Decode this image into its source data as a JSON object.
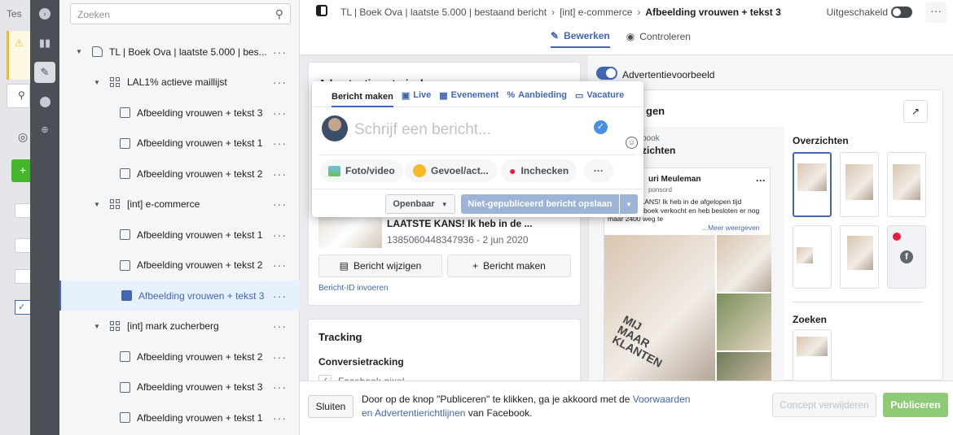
{
  "left": {
    "truncated_label": "Tes"
  },
  "rail": {
    "items": [
      "expand-icon",
      "chart-icon",
      "pencil-icon",
      "clock-icon",
      "search-chart-icon"
    ]
  },
  "search": {
    "placeholder": "Zoeken"
  },
  "tree": [
    {
      "label": "TL | Boek Ova | laatste 5.000 | bes...",
      "type": "campaign",
      "level": 0,
      "selected": false
    },
    {
      "label": "LAL1% actieve maillijst",
      "type": "adset",
      "level": 1,
      "selected": false
    },
    {
      "label": "Afbeelding vrouwen + tekst 3",
      "type": "ad",
      "level": 2,
      "selected": false
    },
    {
      "label": "Afbeelding vrouwen + tekst 1",
      "type": "ad",
      "level": 2,
      "selected": false
    },
    {
      "label": "Afbeelding vrouwen + tekst 2",
      "type": "ad",
      "level": 2,
      "selected": false
    },
    {
      "label": "[int] e-commerce",
      "type": "adset",
      "level": 1,
      "selected": false
    },
    {
      "label": "Afbeelding vrouwen + tekst 1",
      "type": "ad",
      "level": 2,
      "selected": false
    },
    {
      "label": "Afbeelding vrouwen + tekst 2",
      "type": "ad",
      "level": 2,
      "selected": false
    },
    {
      "label": "Afbeelding vrouwen + tekst 3",
      "type": "ad",
      "level": 2,
      "selected": true
    },
    {
      "label": "[int] mark zucherberg",
      "type": "adset",
      "level": 1,
      "selected": false
    },
    {
      "label": "Afbeelding vrouwen + tekst 2",
      "type": "ad",
      "level": 2,
      "selected": false
    },
    {
      "label": "Afbeelding vrouwen + tekst 3",
      "type": "ad",
      "level": 2,
      "selected": false
    },
    {
      "label": "Afbeelding vrouwen + tekst 1",
      "type": "ad",
      "level": 2,
      "selected": false
    }
  ],
  "breadcrumb": {
    "part1": "TL | Boek Ova | laatste 5.000 | bestaand bericht",
    "part2": "[int] e-commerce",
    "part3": "Afbeelding vrouwen + tekst 3"
  },
  "status": {
    "label": "Uitgeschakeld"
  },
  "tabs": {
    "edit": "Bewerken",
    "review": "Controleren"
  },
  "creative": {
    "section_title": "Advertentiemateriaal",
    "post_text": "LAATSTE KANS! Ik heb in de ...",
    "post_meta": "1385060448347936 - 2 jun 2020",
    "change_post": "Bericht wijzigen",
    "create_post": "Bericht maken",
    "enter_id": "Bericht-ID invoeren"
  },
  "tracking": {
    "title": "Tracking",
    "conversion": "Conversietracking",
    "pixel": "Facebook-pixel"
  },
  "preview": {
    "toggle_label": "Advertentievoorbeeld",
    "header_partial": "gen",
    "overviews": "Overzichten",
    "search": "Zoeken",
    "feed_partial1": "book",
    "feed_partial2": "zichten",
    "page_name_partial": "uri Meuleman",
    "sponsored_partial": "ponsord",
    "post_copy": "LAATSTE KANS! Ik heb in de afgelopen tijd 18.000x dit boek verkocht en heb besloten er nog maar 2400 weg te",
    "more": "...Meer weergeven",
    "book_text": "MIJ MAAR KLANTEN"
  },
  "modal": {
    "tabs": [
      "Bericht maken",
      "Live",
      "Evenement",
      "Aanbieding",
      "Vacature"
    ],
    "placeholder": "Schrijf een bericht...",
    "actions": [
      "Foto/video",
      "Gevoel/act...",
      "Inchecken"
    ],
    "audience": "Openbaar",
    "save": "Niet-gepubliceerd bericht opslaan"
  },
  "footer": {
    "close": "Sluiten",
    "text_before": "Door op de knop \"Publiceren\" te klikken, ga je akkoord met de ",
    "link": "Voorwaarden en Advertentierichtlijnen",
    "text_after": " van Facebook.",
    "delete_draft": "Concept verwijderen",
    "publish": "Publiceren"
  },
  "colors": {
    "brand": "#4267b2",
    "publish": "#8fcb77",
    "save_disabled": "#9cb4d8"
  }
}
